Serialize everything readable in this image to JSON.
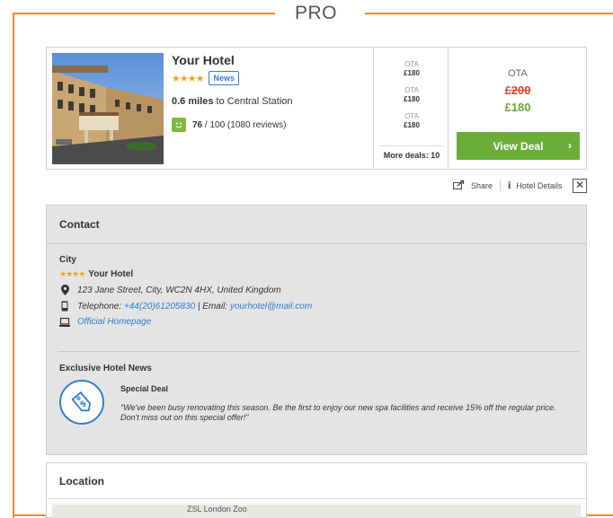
{
  "header": {
    "title": "PRO"
  },
  "hotel": {
    "name": "Your Hotel",
    "stars": "★★★★",
    "badge": "News",
    "distance_value": "0.6 miles",
    "distance_text": " to Central Station",
    "rating_score": "76",
    "rating_rest": " / 100 (1080 reviews)"
  },
  "ota_list": [
    {
      "label": "OTA",
      "price": "£180"
    },
    {
      "label": "OTA",
      "price": "£180"
    },
    {
      "label": "OTA",
      "price": "£180"
    }
  ],
  "more_deals": "More deals: 10",
  "deal": {
    "provider": "OTA",
    "old_price": "£200",
    "new_price": "£180",
    "button": "View Deal"
  },
  "actions": {
    "share": "Share",
    "details": "Hotel Details",
    "close": "✕"
  },
  "contact": {
    "title": "Contact",
    "city": "City",
    "stars": "★★★★",
    "hotel_name": "Your Hotel",
    "address": "123 Jane Street, City, WC2N 4HX, United Kingdom",
    "telephone_label": "Telephone: ",
    "telephone": "+44(20)61205830",
    "email_label": " | Email: ",
    "email": "yourhotel@mail.com",
    "homepage": "Official Homepage"
  },
  "news": {
    "title": "Exclusive Hotel News",
    "deal_title": "Special Deal",
    "deal_text": "\"We've been busy renovating this season. Be the first to enjoy our new spa facilities and receive 15% off the regular price. Don't miss out on this special offer!\""
  },
  "location": {
    "title": "Location",
    "map_label": "ZSL London Zoo"
  },
  "colors": {
    "accent": "#ef8a2e",
    "green": "#6cad3a",
    "link": "#2e7fd0",
    "strike": "#d9452d"
  }
}
